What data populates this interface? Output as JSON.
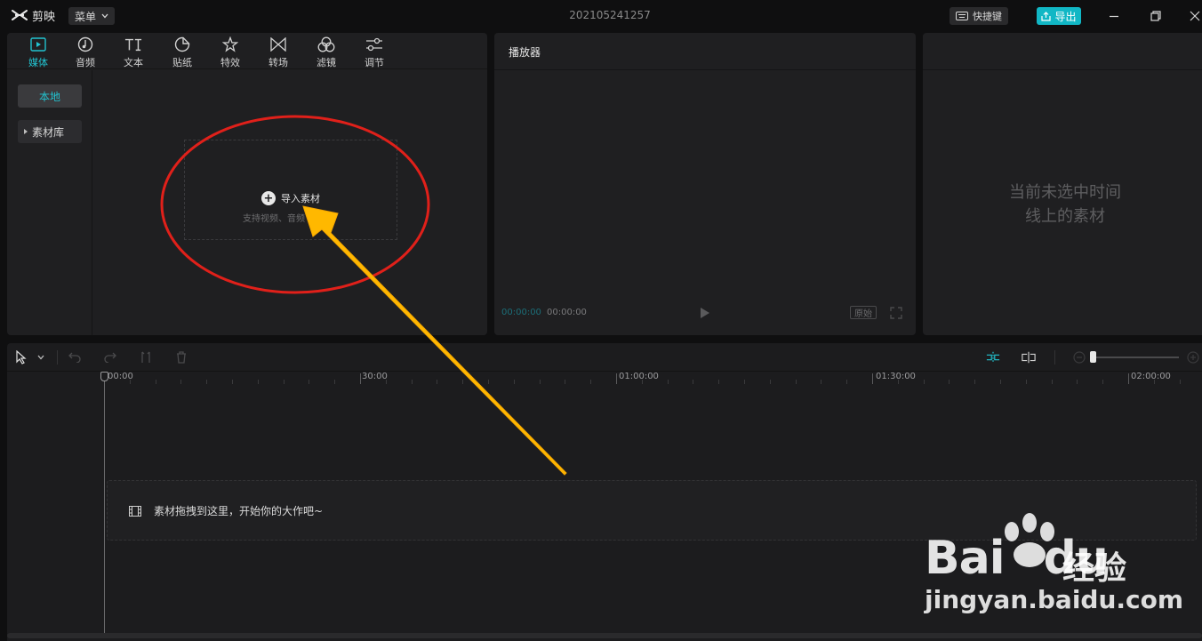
{
  "app": {
    "name": "剪映",
    "menu_label": "菜单",
    "project_title": "202105241257",
    "shortcut_label": "快捷键",
    "export_label": "导出"
  },
  "media_panel": {
    "tabs": [
      {
        "label": "媒体",
        "icon": "media-icon",
        "active": true
      },
      {
        "label": "音频",
        "icon": "audio-icon",
        "active": false
      },
      {
        "label": "文本",
        "icon": "text-icon",
        "active": false
      },
      {
        "label": "贴纸",
        "icon": "sticker-icon",
        "active": false
      },
      {
        "label": "特效",
        "icon": "effects-icon",
        "active": false
      },
      {
        "label": "转场",
        "icon": "transition-icon",
        "active": false
      },
      {
        "label": "滤镜",
        "icon": "filter-icon",
        "active": false
      },
      {
        "label": "调节",
        "icon": "adjust-icon",
        "active": false
      }
    ],
    "side": {
      "local_label": "本地",
      "library_label": "素材库"
    },
    "import": {
      "label": "导入素材",
      "sublabel": "支持视频、音频"
    }
  },
  "player": {
    "title": "播放器",
    "current_time": "00:00:00",
    "total_time": "00:00:00",
    "original_label": "原始"
  },
  "detail": {
    "empty_line1": "当前未选中时间",
    "empty_line2": "线上的素材"
  },
  "timeline": {
    "ruler_labels": [
      "00:00",
      "30:00",
      "01:00:00",
      "01:30:00",
      "02:00:00"
    ],
    "track_hint": "素材拖拽到这里，开始你的大作吧~"
  },
  "watermark": {
    "brand": "Bai",
    "brand_du": "du",
    "brand_cn": "经验",
    "url": "jingyan.baidu.com"
  },
  "colors": {
    "accent": "#22c3d0",
    "export_bg": "#11b7c5",
    "annotation_red": "#e0201a",
    "annotation_arrow": "#ffb800"
  }
}
